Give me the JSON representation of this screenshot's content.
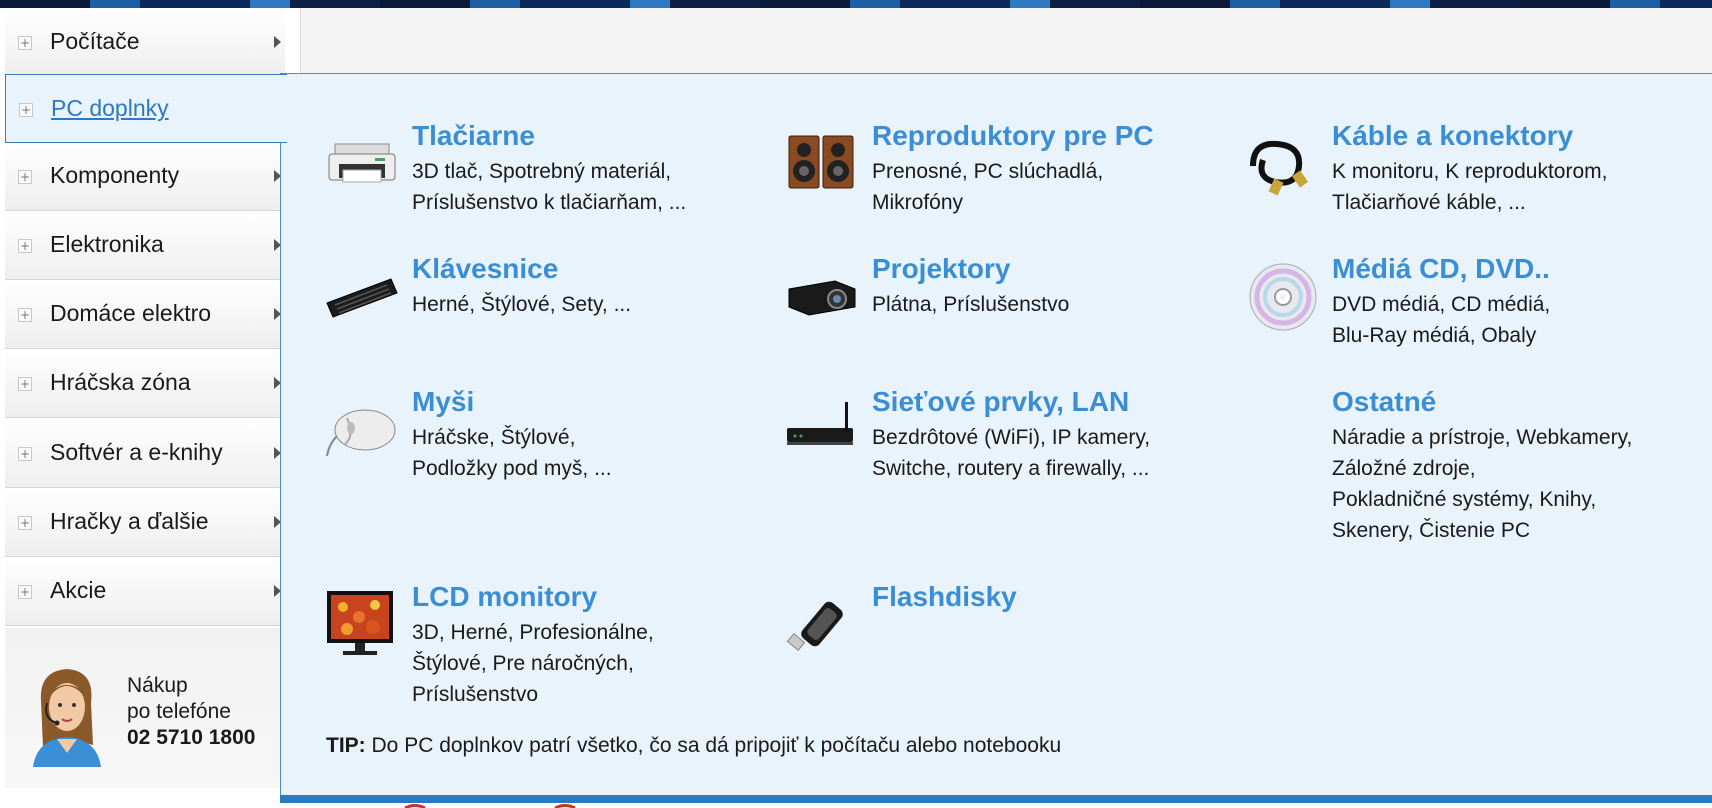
{
  "sidebar": {
    "items": [
      {
        "label": "Počítače",
        "active": false
      },
      {
        "label": "PC doplnky",
        "active": true
      },
      {
        "label": "Komponenty",
        "active": false
      },
      {
        "label": "Elektronika",
        "active": false
      },
      {
        "label": "Domáce elektro",
        "active": false
      },
      {
        "label": "Hráčska zóna",
        "active": false
      },
      {
        "label": "Softvér a e-knihy",
        "active": false
      },
      {
        "label": "Hračky a ďalšie",
        "active": false
      },
      {
        "label": "Akcie",
        "active": false
      }
    ],
    "phone": {
      "line1": "Nákup",
      "line2": "po telefóne",
      "number": "02 5710 1800"
    }
  },
  "panel": {
    "categories": [
      {
        "title": "Tlačiarne",
        "icon": "printer-icon",
        "links": [
          "3D tlač",
          "Spotrebný materiál",
          "Príslušenstvo k tlačiarňam",
          "..."
        ]
      },
      {
        "title": "Reproduktory pre PC",
        "icon": "speakers-icon",
        "links": [
          "Prenosné",
          "PC slúchadlá",
          "Mikrofóny"
        ]
      },
      {
        "title": "Káble a konektory",
        "icon": "cable-icon",
        "links": [
          "K monitoru",
          "K reproduktorom",
          "Tlačiarňové káble",
          "..."
        ]
      },
      {
        "title": "Klávesnice",
        "icon": "keyboard-icon",
        "links": [
          "Herné",
          "Štýlové",
          "Sety",
          "..."
        ]
      },
      {
        "title": "Projektory",
        "icon": "projector-icon",
        "links": [
          "Plátna",
          "Príslušenstvo"
        ]
      },
      {
        "title": "Médiá CD, DVD..",
        "icon": "cd-icon",
        "links": [
          "DVD médiá",
          "CD médiá",
          "Blu-Ray médiá",
          "Obaly"
        ]
      },
      {
        "title": "Myši",
        "icon": "mouse-icon",
        "links": [
          "Hráčske",
          "Štýlové",
          "Podložky pod myš",
          "..."
        ]
      },
      {
        "title": "Sieťové prvky, LAN",
        "icon": "router-icon",
        "links": [
          "Bezdrôtové (WiFi)",
          "IP kamery",
          "Switche, routery a firewally",
          "..."
        ]
      },
      {
        "title": "Ostatné",
        "icon": "",
        "links": [
          "Náradie a prístroje",
          "Webkamery",
          "Záložné zdroje",
          "Pokladničné systémy",
          "Knihy",
          "Skenery",
          "Čistenie PC"
        ]
      },
      {
        "title": "LCD monitory",
        "icon": "monitor-icon",
        "links": [
          "3D",
          "Herné",
          "Profesionálne",
          "Štýlové",
          "Pre náročných",
          "Príslušenstvo"
        ]
      },
      {
        "title": "Flashdisky",
        "icon": "usb-flash-icon",
        "links": []
      }
    ],
    "tip_label": "TIP:",
    "tip_text": "Do PC doplnkov patrí všetko, čo sa dá pripojiť k počítaču alebo notebooku"
  },
  "colors": {
    "accent": "#3b8ed3",
    "panel_bg": "#e9f3fb",
    "panel_border": "#2b79c0"
  }
}
